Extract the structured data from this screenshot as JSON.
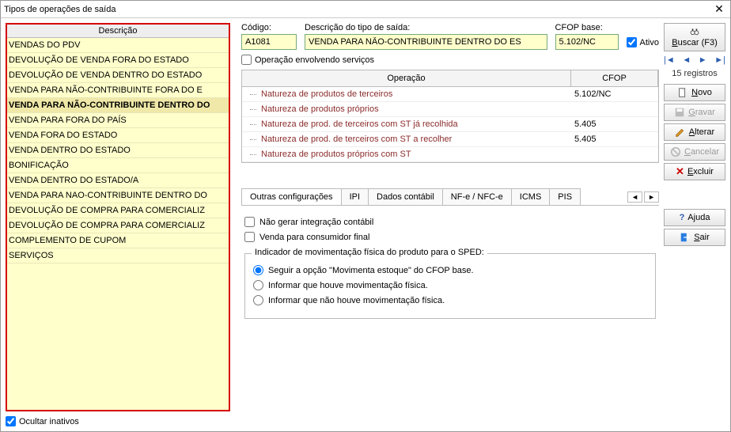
{
  "window": {
    "title": "Tipos de operações de saída"
  },
  "list": {
    "header": "Descrição",
    "items": [
      "VENDAS DO PDV",
      "DEVOLUÇÃO DE VENDA FORA DO ESTADO",
      "DEVOLUÇÃO DE VENDA DENTRO DO ESTADO",
      "VENDA PARA NÃO-CONTRIBUINTE FORA DO E",
      "VENDA PARA NÃO-CONTRIBUINTE DENTRO DO",
      "VENDA PARA FORA DO PAÍS",
      "VENDA FORA DO ESTADO",
      "VENDA DENTRO DO ESTADO",
      "BONIFICAÇÃO",
      "VENDA DENTRO DO ESTADO/A",
      "VENDA PARA NAO-CONTRIBUINTE DENTRO DO",
      "DEVOLUÇÃO DE COMPRA PARA COMERCIALIZ",
      "DEVOLUÇÃO DE COMPRA PARA COMERCIALIZ",
      "COMPLEMENTO DE CUPOM",
      "SERVIÇOS"
    ],
    "selected_index": 4,
    "ocultar_label": "Ocultar inativos"
  },
  "form": {
    "codigo_label": "Código:",
    "codigo_value": "A1081",
    "desc_label": "Descrição do tipo de saída:",
    "desc_value": "VENDA PARA NÃO-CONTRIBUINTE DENTRO DO ES",
    "cfop_label": "CFOP base:",
    "cfop_value": "5.102/NC",
    "ativo_label": "Ativo",
    "serv_label": "Operação envolvendo serviços"
  },
  "grid": {
    "col1": "Operação",
    "col2": "CFOP",
    "rows": [
      {
        "op": "Natureza de produtos de terceiros",
        "cfop": "5.102/NC"
      },
      {
        "op": "Natureza de produtos próprios",
        "cfop": ""
      },
      {
        "op": "Natureza de prod. de terceiros com ST já recolhida",
        "cfop": "5.405"
      },
      {
        "op": "Natureza de prod. de terceiros com ST a recolher",
        "cfop": "5.405"
      },
      {
        "op": "Natureza de produtos próprios com ST",
        "cfop": ""
      }
    ]
  },
  "tabs": {
    "items": [
      "Outras configurações",
      "IPI",
      "Dados contábil",
      "NF-e / NFC-e",
      "ICMS",
      "PIS"
    ],
    "active_index": 0
  },
  "outras": {
    "chk1": "Não gerar integração contábil",
    "chk2": "Venda para consumidor final",
    "group_legend": "Indicador de movimentação física do produto para o SPED:",
    "r1": "Seguir a opção \"Movimenta estoque\" do CFOP base.",
    "r2": "Informar que houve movimentação física.",
    "r3": "Informar que não houve movimentação física."
  },
  "toolbar": {
    "buscar": "Buscar (F3)",
    "registros": "15 registros",
    "novo": "Novo",
    "gravar": "Gravar",
    "alterar": "Alterar",
    "cancelar": "Cancelar",
    "excluir": "Excluir",
    "ajuda": "Ajuda",
    "sair": "Sair"
  },
  "icons": {
    "search": "binoculars-icon",
    "first": "nav-first-icon",
    "prev": "nav-prev-icon",
    "next": "nav-next-icon",
    "last": "nav-last-icon",
    "novo": "new-file-icon",
    "gravar": "save-icon",
    "alterar": "edit-icon",
    "cancelar": "cancel-icon",
    "excluir": "delete-x-icon",
    "ajuda": "help-icon",
    "sair": "exit-icon"
  }
}
